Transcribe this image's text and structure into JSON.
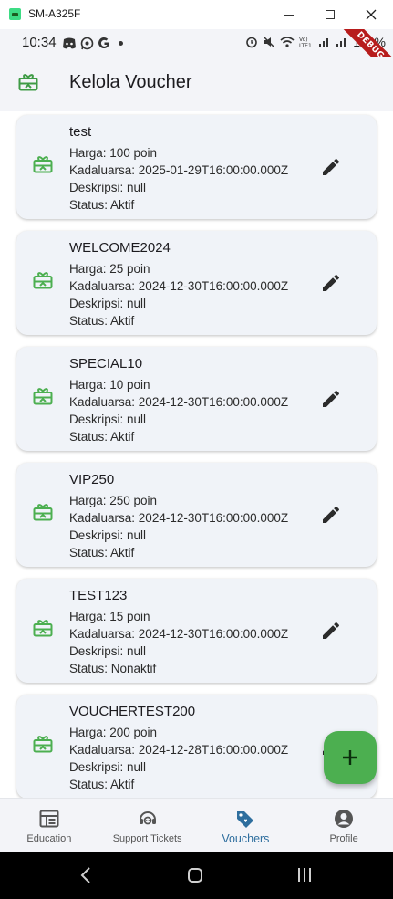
{
  "window": {
    "title": "SM-A325F"
  },
  "statusbar": {
    "time": "10:34",
    "battery": "100%",
    "debug": "DEBUG"
  },
  "appbar": {
    "title": "Kelola Voucher"
  },
  "vouchers": [
    {
      "code": "test",
      "harga": "Harga: 100 poin",
      "kadaluarsa": "Kadaluarsa: 2025-01-29T16:00:00.000Z",
      "deskripsi": "Deskripsi: null",
      "status": "Status: Aktif"
    },
    {
      "code": "WELCOME2024",
      "harga": "Harga: 25 poin",
      "kadaluarsa": "Kadaluarsa: 2024-12-30T16:00:00.000Z",
      "deskripsi": "Deskripsi: null",
      "status": "Status: Aktif"
    },
    {
      "code": "SPECIAL10",
      "harga": "Harga: 10 poin",
      "kadaluarsa": "Kadaluarsa: 2024-12-30T16:00:00.000Z",
      "deskripsi": "Deskripsi: null",
      "status": "Status: Aktif"
    },
    {
      "code": "VIP250",
      "harga": "Harga: 250 poin",
      "kadaluarsa": "Kadaluarsa: 2024-12-30T16:00:00.000Z",
      "deskripsi": "Deskripsi: null",
      "status": "Status: Aktif"
    },
    {
      "code": "TEST123",
      "harga": "Harga: 15 poin",
      "kadaluarsa": "Kadaluarsa: 2024-12-30T16:00:00.000Z",
      "deskripsi": "Deskripsi: null",
      "status": "Status: Nonaktif"
    },
    {
      "code": "VOUCHERTEST200",
      "harga": "Harga: 200 poin",
      "kadaluarsa": "Kadaluarsa: 2024-12-28T16:00:00.000Z",
      "deskripsi": "Deskripsi: null",
      "status": "Status: Aktif"
    }
  ],
  "bottomnav": {
    "items": [
      {
        "label": "Education",
        "icon": "education-icon"
      },
      {
        "label": "Support Tickets",
        "icon": "support-icon"
      },
      {
        "label": "Vouchers",
        "icon": "voucher-tag-icon",
        "active": true
      },
      {
        "label": "Profile",
        "icon": "profile-icon"
      }
    ]
  },
  "colors": {
    "accent": "#4caf50",
    "active_nav": "#2e6e9e",
    "card_bg": "#f0f3f8"
  }
}
